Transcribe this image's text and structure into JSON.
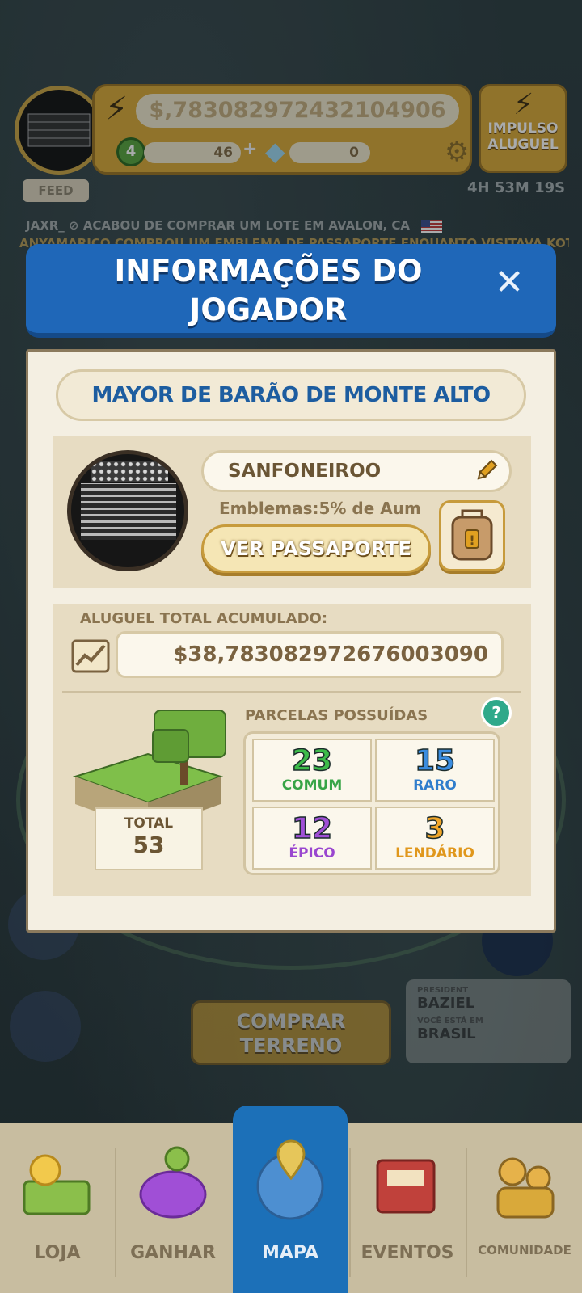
{
  "hud": {
    "money": "$,783082972432104906",
    "level": "4",
    "xp": "46",
    "gems": "0",
    "impulso_label": "IMPULSO\nALUGUEL",
    "timer": "4H 53M 19S"
  },
  "feed": {
    "button_label": "FEED",
    "line1": "JAXR_ ⊘ ACABOU DE COMPRAR UM LOTE EM AVALON, CA",
    "line2": "ANYAMARICO COMPROU UM EMBLEMA DE PASSAPORTE ENQUANTO VISITAVA KOTCI"
  },
  "modal": {
    "title": "INFORMAÇÕES DO\nJOGADOR",
    "player_title": "MAYOR DE BARÃO DE MONTE ALTO",
    "player_name": "SANFONEIROO",
    "emblemas": "Emblemas:5% de Aum",
    "passport_button": "VER PASSAPORTE",
    "rent_label": "ALUGUEL TOTAL ACUMULADO:",
    "rent_value": "$38,783082972676003090",
    "parcels_label": "PARCELAS POSSUÍDAS",
    "total_label": "TOTAL",
    "total_value": "53",
    "parcels": [
      {
        "count": "23",
        "label": "COMUM",
        "color": "#3dbb4a",
        "text": "#37a446"
      },
      {
        "count": "15",
        "label": "RARO",
        "color": "#3b8de0",
        "text": "#2f7dcc"
      },
      {
        "count": "12",
        "label": "ÉPICO",
        "color": "#a04fd6",
        "text": "#9a46cf"
      },
      {
        "count": "3",
        "label": "LENDÁRIO",
        "color": "#f0a62a",
        "text": "#e0971c"
      }
    ]
  },
  "lower": {
    "buy_button": "COMPRAR\nTERRENO",
    "president_small": "PRESIDENT",
    "president_name": "BAZIEL",
    "location_small": "VOCÊ ESTÁ EM",
    "location_name": "BRASIL"
  },
  "nav": {
    "items": [
      {
        "label": "LOJA"
      },
      {
        "label": "GANHAR"
      },
      {
        "label": "MAPA"
      },
      {
        "label": "EVENTOS"
      },
      {
        "label": "COMUNIDADE"
      }
    ]
  },
  "colors": {
    "header_blue": "#1f67b8",
    "gold": "#d9a93a",
    "panel_cream": "#f4efe2"
  }
}
